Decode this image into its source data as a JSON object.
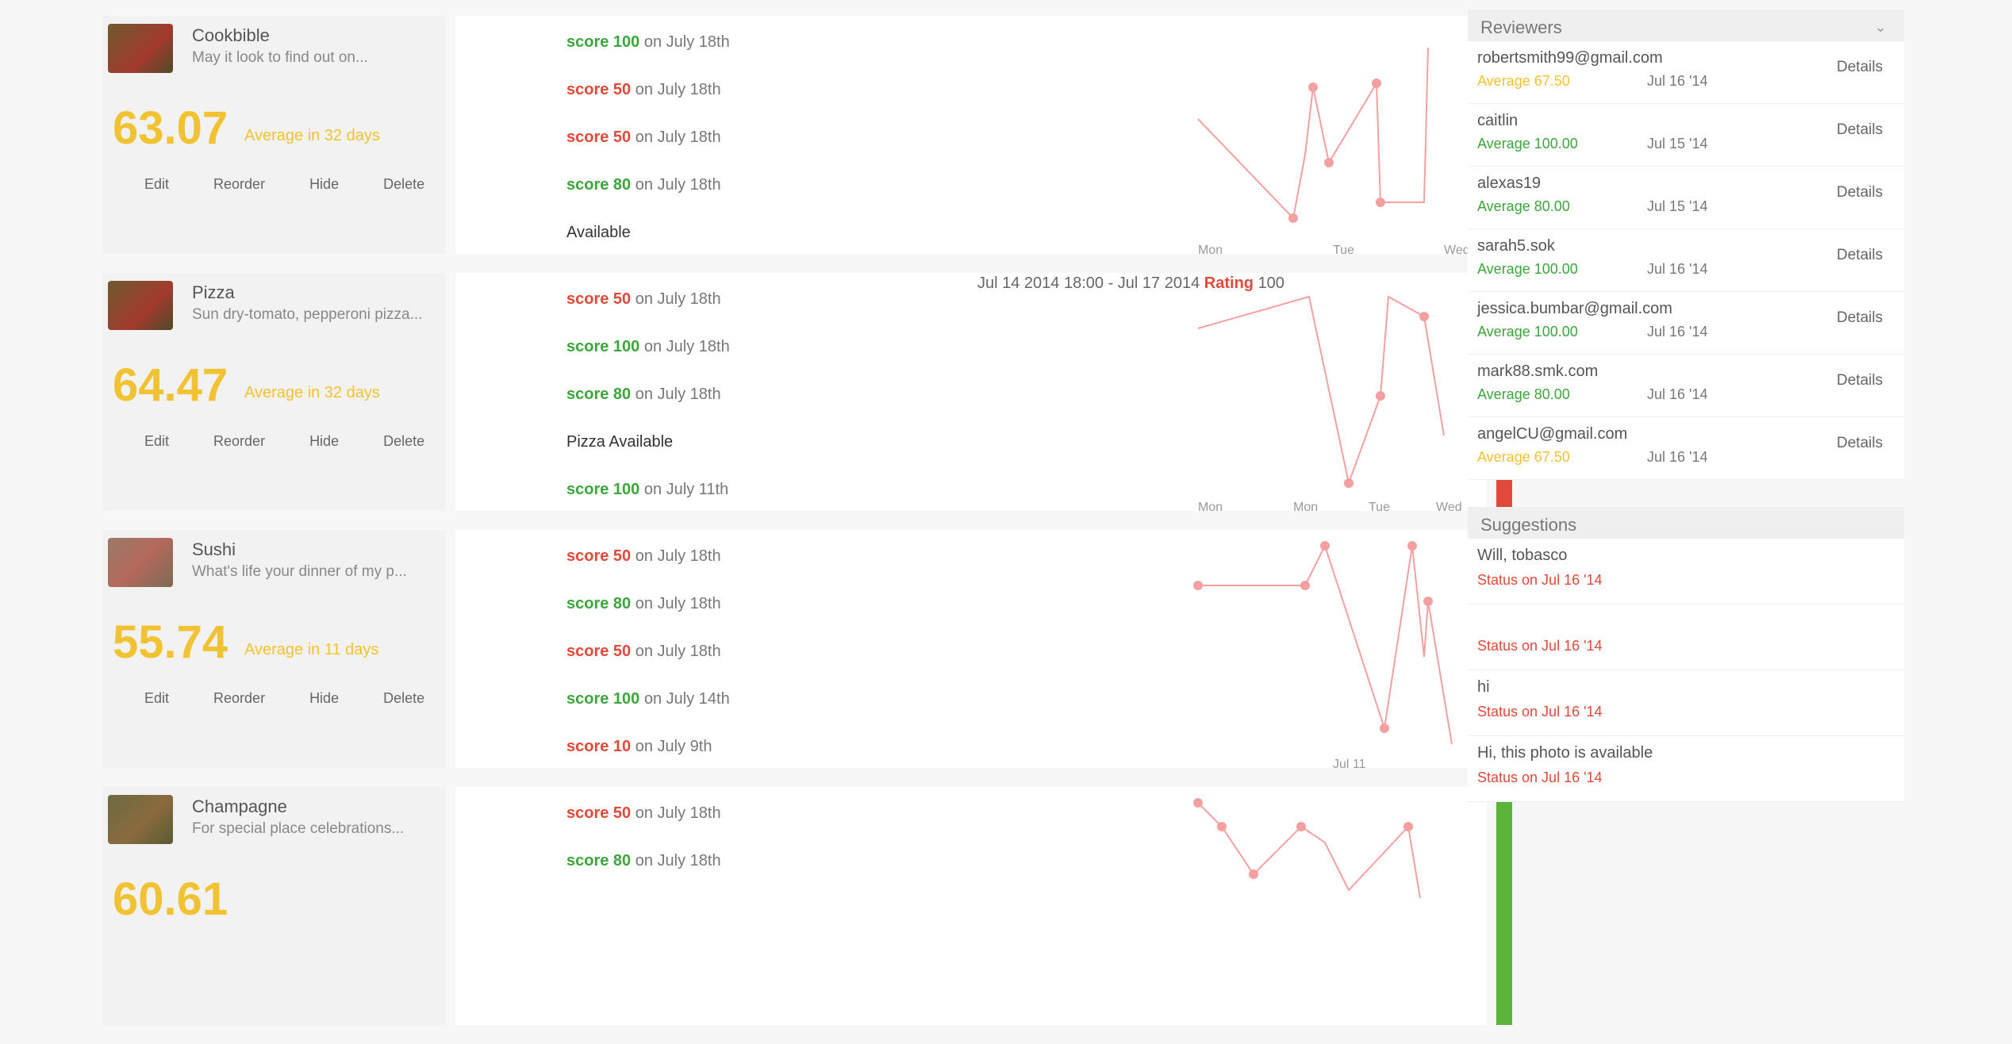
{
  "products": [
    {
      "name": "Cookbible",
      "desc": "May it look to find out on...",
      "score": "63.07",
      "avg": "Average in 32 days",
      "actions": [
        "Edit",
        "Reorder",
        "Hide",
        "Delete"
      ],
      "reviews": [
        {
          "score": "score 100",
          "tone": "green",
          "text": "on July 18th"
        },
        {
          "score": "score 50",
          "tone": "red",
          "text": "on July 18th"
        },
        {
          "score": "score 50",
          "tone": "red",
          "text": "on July 18th"
        },
        {
          "score": "score 80",
          "tone": "green",
          "text": "on July 18th"
        },
        {
          "score": "",
          "tone": "plain",
          "text": "Available"
        }
      ],
      "chart_labels": [
        "Mon",
        "Tue",
        "Wed"
      ]
    },
    {
      "name": "Pizza",
      "desc": "Sun dry-tomato, pepperoni pizza...",
      "score": "64.47",
      "avg": "Average in 32 days",
      "actions": [
        "Edit",
        "Reorder",
        "Hide",
        "Delete"
      ],
      "reviews": [
        {
          "score": "score 50",
          "tone": "red",
          "text": "on July 18th"
        },
        {
          "score": "score 100",
          "tone": "green",
          "text": "on July 18th"
        },
        {
          "score": "score 80",
          "tone": "green",
          "text": "on July 18th"
        },
        {
          "score": "",
          "tone": "plain",
          "text": "Pizza Available"
        },
        {
          "score": "score 100",
          "tone": "green",
          "text": "on July 11th"
        }
      ],
      "chart_labels": [
        "Mon",
        "Mon",
        "Tue",
        "Wed"
      ]
    },
    {
      "name": "Sushi",
      "desc": "What's life your dinner of my p...",
      "score": "55.74",
      "avg": "Average in 11 days",
      "actions": [
        "Edit",
        "Reorder",
        "Hide",
        "Delete"
      ],
      "reviews": [
        {
          "score": "score 50",
          "tone": "red",
          "text": "on July 18th"
        },
        {
          "score": "score 80",
          "tone": "green",
          "text": "on July 18th"
        },
        {
          "score": "score 50",
          "tone": "red",
          "text": "on July 18th"
        },
        {
          "score": "score 100",
          "tone": "green",
          "text": "on July 14th"
        },
        {
          "score": "score 10",
          "tone": "red",
          "text": "on July 9th"
        }
      ],
      "chart_labels": [
        "Jul 11"
      ]
    },
    {
      "name": "Champagne",
      "desc": "For special place celebrations...",
      "score": "60.61",
      "avg": "",
      "actions": [
        "Edit",
        "Reorder",
        "Hide",
        "Delete"
      ],
      "reviews": [
        {
          "score": "score 50",
          "tone": "red",
          "text": "on July 18th"
        },
        {
          "score": "score 80",
          "tone": "green",
          "text": "on July 18th"
        }
      ],
      "chart_labels": []
    }
  ],
  "tooltip": {
    "prefix": "Jul 14 2014 18:00 - Jul 17 2014",
    "value": "Rating",
    "suffix": "100"
  },
  "reviewers": {
    "title": "Reviewers",
    "caret": "⌄",
    "items": [
      {
        "user": "robertsmith99@gmail.com",
        "avg": "Average 67.50",
        "tone": "yellow",
        "date": "Jul 16 '14",
        "detail": "Details"
      },
      {
        "user": "caitlin",
        "avg": "Average 100.00",
        "tone": "green",
        "date": "Jul 15 '14",
        "detail": "Details"
      },
      {
        "user": "alexas19",
        "avg": "Average 80.00",
        "tone": "green",
        "date": "Jul 15 '14",
        "detail": "Details"
      },
      {
        "user": "sarah5.sok",
        "avg": "Average 100.00",
        "tone": "green",
        "date": "Jul 16 '14",
        "detail": "Details"
      },
      {
        "user": "jessica.bumbar@gmail.com",
        "avg": "Average 100.00",
        "tone": "green",
        "date": "Jul 16 '14",
        "detail": "Details"
      },
      {
        "user": "mark88.smk.com",
        "avg": "Average 80.00",
        "tone": "green",
        "date": "Jul 16 '14",
        "detail": "Details"
      },
      {
        "user": "angelCU@gmail.com",
        "avg": "Average 67.50",
        "tone": "yellow",
        "date": "Jul 16 '14",
        "detail": "Details"
      }
    ]
  },
  "suggestions": {
    "title": "Suggestions",
    "items": [
      {
        "text": "Will, tobasco",
        "meta": "Status on Jul 16 '14"
      },
      {
        "text": "",
        "meta": "Status on Jul 16 '14"
      },
      {
        "text": "hi",
        "meta": "Status on Jul 16 '14"
      },
      {
        "text": "Hi, this photo is available",
        "meta": "Status on Jul 16 '14"
      }
    ]
  },
  "colors": {
    "green": "#3ca63c",
    "red": "#e04a3a",
    "yellow": "#f1c232",
    "line": "#f4a0a0"
  }
}
